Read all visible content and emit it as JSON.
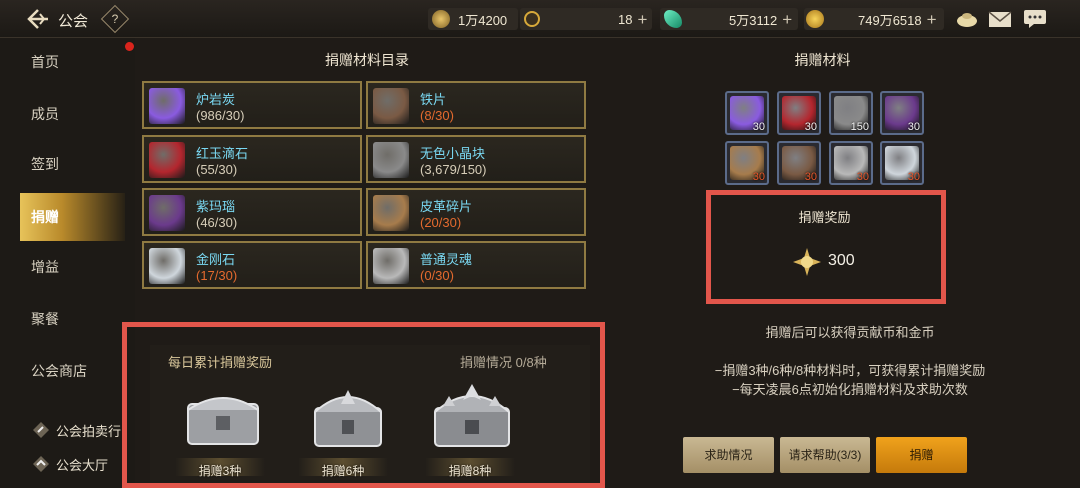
{
  "header": {
    "title": "公会",
    "help_label": "?",
    "resources": [
      {
        "name": "contribution-coin",
        "value": "1万4200",
        "color": "#c9a24a"
      },
      {
        "name": "c-currency",
        "value": "18",
        "color": "#d7a93a"
      },
      {
        "name": "green-gem",
        "value": "5万3112",
        "color": "#2fc39a"
      },
      {
        "name": "gold-coin",
        "value": "749万6518",
        "color": "#e2b233"
      }
    ],
    "plus_label": "+"
  },
  "sidebar": {
    "items": [
      {
        "label": "首页"
      },
      {
        "label": "成员"
      },
      {
        "label": "签到"
      },
      {
        "label": "捐赠"
      },
      {
        "label": "增益"
      },
      {
        "label": "聚餐"
      },
      {
        "label": "公会商店"
      }
    ],
    "active_index": 3,
    "sub_items": [
      {
        "label": "公会拍卖行"
      },
      {
        "label": "公会大厅"
      }
    ]
  },
  "catalog": {
    "title": "捐赠材料目录",
    "materials": [
      {
        "name": "炉岩炭",
        "count": "(986/30)",
        "low": false,
        "icon": "purple-orb-icon",
        "color": "#8a5be0"
      },
      {
        "name": "铁片",
        "count": "(8/30)",
        "low": true,
        "icon": "iron-plate-icon",
        "color": "#7a5a44"
      },
      {
        "name": "红玉滴石",
        "count": "(55/30)",
        "low": false,
        "icon": "red-gem-icon",
        "color": "#b4262e"
      },
      {
        "name": "无色小晶块",
        "count": "(3,679/150)",
        "low": false,
        "icon": "clear-crystal-icon",
        "color": "#8a8a8a"
      },
      {
        "name": "紫玛瑙",
        "count": "(46/30)",
        "low": false,
        "icon": "purple-agate-icon",
        "color": "#6b3a8c"
      },
      {
        "name": "皮革碎片",
        "count": "(20/30)",
        "low": true,
        "icon": "leather-scrap-icon",
        "color": "#a77c4c"
      },
      {
        "name": "金刚石",
        "count": "(17/30)",
        "low": true,
        "icon": "diamond-icon",
        "color": "#cfd6dc"
      },
      {
        "name": "普通灵魂",
        "count": "(0/30)",
        "low": true,
        "icon": "soul-orb-icon",
        "color": "#b9b9b9"
      }
    ]
  },
  "daily_reward": {
    "title": "每日累计捐赠奖励",
    "status_label": "捐赠情况",
    "status_count": "0/8种",
    "chests": [
      {
        "label": "捐赠3种"
      },
      {
        "label": "捐赠6种"
      },
      {
        "label": "捐赠8种"
      }
    ]
  },
  "donation": {
    "title": "捐赠材料",
    "slots": [
      {
        "qty": "30",
        "low": false,
        "icon": "purple-orb-icon",
        "color": "#8a5be0"
      },
      {
        "qty": "30",
        "low": false,
        "icon": "red-gem-icon",
        "color": "#b4262e"
      },
      {
        "qty": "150",
        "low": false,
        "icon": "clear-crystal-icon",
        "color": "#8a8a8a"
      },
      {
        "qty": "30",
        "low": false,
        "icon": "purple-agate-icon",
        "color": "#6b3a8c"
      },
      {
        "qty": "30",
        "low": true,
        "icon": "leather-scrap-icon",
        "color": "#a77c4c"
      },
      {
        "qty": "30",
        "low": true,
        "icon": "iron-plate-icon",
        "color": "#7a5a44"
      },
      {
        "qty": "30",
        "low": true,
        "icon": "soul-orb-icon",
        "color": "#b9b9b9"
      },
      {
        "qty": "30",
        "low": true,
        "icon": "diamond-icon",
        "color": "#cfd6dc"
      }
    ],
    "reward_title": "捐赠奖励",
    "reward_amount": "300",
    "info": "捐赠后可以获得贡献币和金币",
    "notes": [
      "−捐赠3种/6种/8种材料时，可获得累计捐赠奖励",
      "−每天凌晨6点初始化捐赠材料及求助次数"
    ],
    "buttons": {
      "help_status": "求助情况",
      "request_help": "请求帮助(3/3)",
      "donate": "捐赠"
    }
  }
}
